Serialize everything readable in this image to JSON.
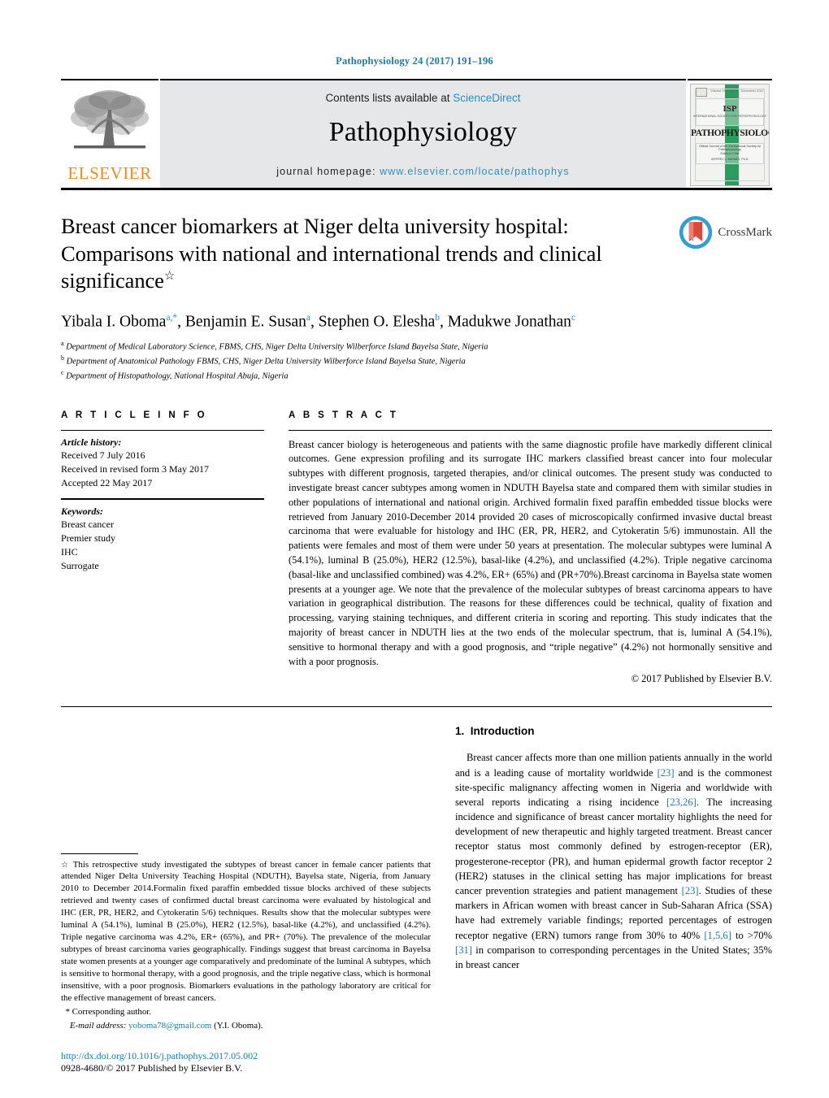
{
  "running_head": "Pathophysiology 24 (2017) 191–196",
  "masthead": {
    "publisher_logo_name": "ELSEVIER",
    "contents_prefix": "Contents lists available at ",
    "contents_link": "ScienceDirect",
    "journal_name": "Pathophysiology",
    "homepage_prefix": "journal homepage: ",
    "homepage_url": "www.elsevier.com/locate/pathophys",
    "cover": {
      "society_mark": "ISP",
      "society_sub": "INTERNATIONAL SOCIETY FOR PATHOPHYSIOLOGY",
      "journal_title": "PATHOPHYSIOLOGY",
      "tagline": "Official Journal of the International Society for Pathophysiology",
      "editor_label": "Editor-in-Chief",
      "editor_name": "JEFFREY L. BARNES, Ph.D.",
      "issn_label": "ISSN 0928-4680",
      "volume_label": "Volume 24  Issue 4",
      "date_label": "December 2017"
    }
  },
  "article": {
    "title": "Breast cancer biomarkers at Niger delta university hospital: Comparisons with national and international trends and clinical significance",
    "title_star": "☆",
    "crossmark_label": "CrossMark",
    "authors": [
      {
        "name": "Yibala I. Oboma",
        "marks": "a,*"
      },
      {
        "name": "Benjamin E. Susan",
        "marks": "a"
      },
      {
        "name": "Stephen O. Elesha",
        "marks": "b"
      },
      {
        "name": "Madukwe Jonathan",
        "marks": "c"
      }
    ],
    "affiliations": [
      {
        "mark": "a",
        "text": "Department of Medical Laboratory Science, FBMS, CHS, Niger Delta University Wilberforce Island Bayelsa State, Nigeria"
      },
      {
        "mark": "b",
        "text": "Department of Anatomical Pathology FBMS, CHS, Niger Delta University Wilberforce Island Bayelsa State, Nigeria"
      },
      {
        "mark": "c",
        "text": "Department of Histopathology, National Hospital Abuja, Nigeria"
      }
    ]
  },
  "article_info": {
    "heading": "A R T I C L E    I N F O",
    "history_label": "Article history:",
    "history": [
      "Received 7 July 2016",
      "Received in revised form 3 May 2017",
      "Accepted 22 May 2017"
    ],
    "keywords_label": "Keywords:",
    "keywords": [
      "Breast cancer",
      "Premier study",
      "IHC",
      "Surrogate"
    ]
  },
  "abstract": {
    "heading": "A B S T R A C T",
    "text": "Breast cancer biology is heterogeneous and patients with the same diagnostic profile have markedly different clinical outcomes. Gene expression profiling and its surrogate IHC markers classified breast cancer into four molecular subtypes with different prognosis, targeted therapies, and/or clinical outcomes. The present study was conducted to investigate breast cancer subtypes among women in NDUTH Bayelsa state and compared them with similar studies in other populations of international and national origin. Archived formalin fixed paraffin embedded tissue blocks were retrieved from January 2010-December 2014 provided 20 cases of microscopically confirmed invasive ductal breast carcinoma that were evaluable for histology and IHC (ER, PR, HER2, and Cytokeratin 5/6) immunostain. All the patients were females and most of them were under 50 years at presentation. The molecular subtypes were luminal A (54.1%), luminal B (25.0%), HER2 (12.5%), basal-like (4.2%), and unclassified (4.2%). Triple negative carcinoma (basal-like and unclassified combined) was 4.2%, ER+ (65%) and (PR+70%).Breast carcinoma in Bayelsa state women presents at a younger age. We note that the prevalence of the molecular subtypes of breast carcinoma appears to have variation in geographical distribution. The reasons for these differences could be technical, quality of fixation and processing, varying staining techniques, and different criteria in scoring and reporting. This study indicates that the majority of breast cancer in NDUTH lies at the two ends of the molecular spectrum, that is, luminal A (54.1%), sensitive to hormonal therapy and with a good prognosis, and “triple negative” (4.2%) not hormonally sensitive and with a poor prognosis.",
    "copyright": "© 2017 Published by Elsevier B.V."
  },
  "footnote": {
    "star": "☆",
    "text": "This retrospective study investigated the subtypes of breast cancer in female cancer patients that attended Niger Delta University Teaching Hospital (NDUTH), Bayelsa state, Nigeria, from January 2010 to December 2014.Formalin fixed paraffin embedded tissue blocks archived of these subjects retrieved and twenty cases of confirmed ductal breast carcinoma were evaluated by histological and IHC (ER, PR, HER2, and Cytokeratin 5/6) techniques. Results show that the molecular subtypes were luminal A (54.1%), luminal B (25.0%), HER2 (12.5%), basal-like (4.2%), and unclassified (4.2%). Triple negative carcinoma was 4.2%, ER+ (65%), and PR+ (70%). The prevalence of the molecular subtypes of breast carcinoma varies geographically. Findings suggest that breast carcinoma in Bayelsa state women presents at a younger age comparatively and predominate of the luminal A subtypes, which is sensitive to hormonal therapy, with a good prognosis, and the triple negative class, which is hormonal insensitive, with a poor prognosis. Biomarkers evaluations in the pathology laboratory are critical for the effective management of breast cancers.",
    "corresponding_mark": "*",
    "corresponding_label": "Corresponding author.",
    "email_label": "E-mail address:",
    "email": "yoboma78@gmail.com",
    "email_owner": "(Y.I. Oboma)."
  },
  "identifiers": {
    "doi": "http://dx.doi.org/10.1016/j.pathophys.2017.05.002",
    "issn_line": "0928-4680/© 2017 Published by Elsevier B.V."
  },
  "introduction": {
    "number": "1.",
    "heading": "Introduction",
    "paragraph_parts": [
      {
        "t": "Breast cancer affects more than one million patients annually in the world and is a leading cause of mortality worldwide "
      },
      {
        "ref": "[23]"
      },
      {
        "t": " and is the commonest site-specific malignancy affecting women in Nigeria and worldwide with several reports indicating a rising incidence "
      },
      {
        "ref": "[23,26]"
      },
      {
        "t": ". The increasing incidence and significance of breast cancer mortality highlights the need for development of new therapeutic and highly targeted treatment. Breast cancer receptor status most commonly defined by estrogen-receptor (ER), progesterone-receptor (PR), and human epidermal growth factor receptor 2 (HER2) statuses in the clinical setting has major implications for breast cancer prevention strategies and patient management "
      },
      {
        "ref": "[23]"
      },
      {
        "t": ". Studies of these markers in African women with breast cancer in Sub-Saharan Africa (SSA) have had extremely variable findings; reported percentages of estrogen receptor negative (ERN) tumors range from 30% to 40% "
      },
      {
        "ref": "[1,5,6]"
      },
      {
        "t": " to >70% "
      },
      {
        "ref": "[31]"
      },
      {
        "t": " in comparison to corresponding percentages in the United States; 35% in breast cancer"
      }
    ]
  },
  "colors": {
    "link": "#1a7aa8",
    "science_direct": "#2b8fc4",
    "elsevier_orange": "#F08A1E",
    "masthead_gray": "#e6e7e8",
    "cover_green": "#2e9b5e"
  }
}
